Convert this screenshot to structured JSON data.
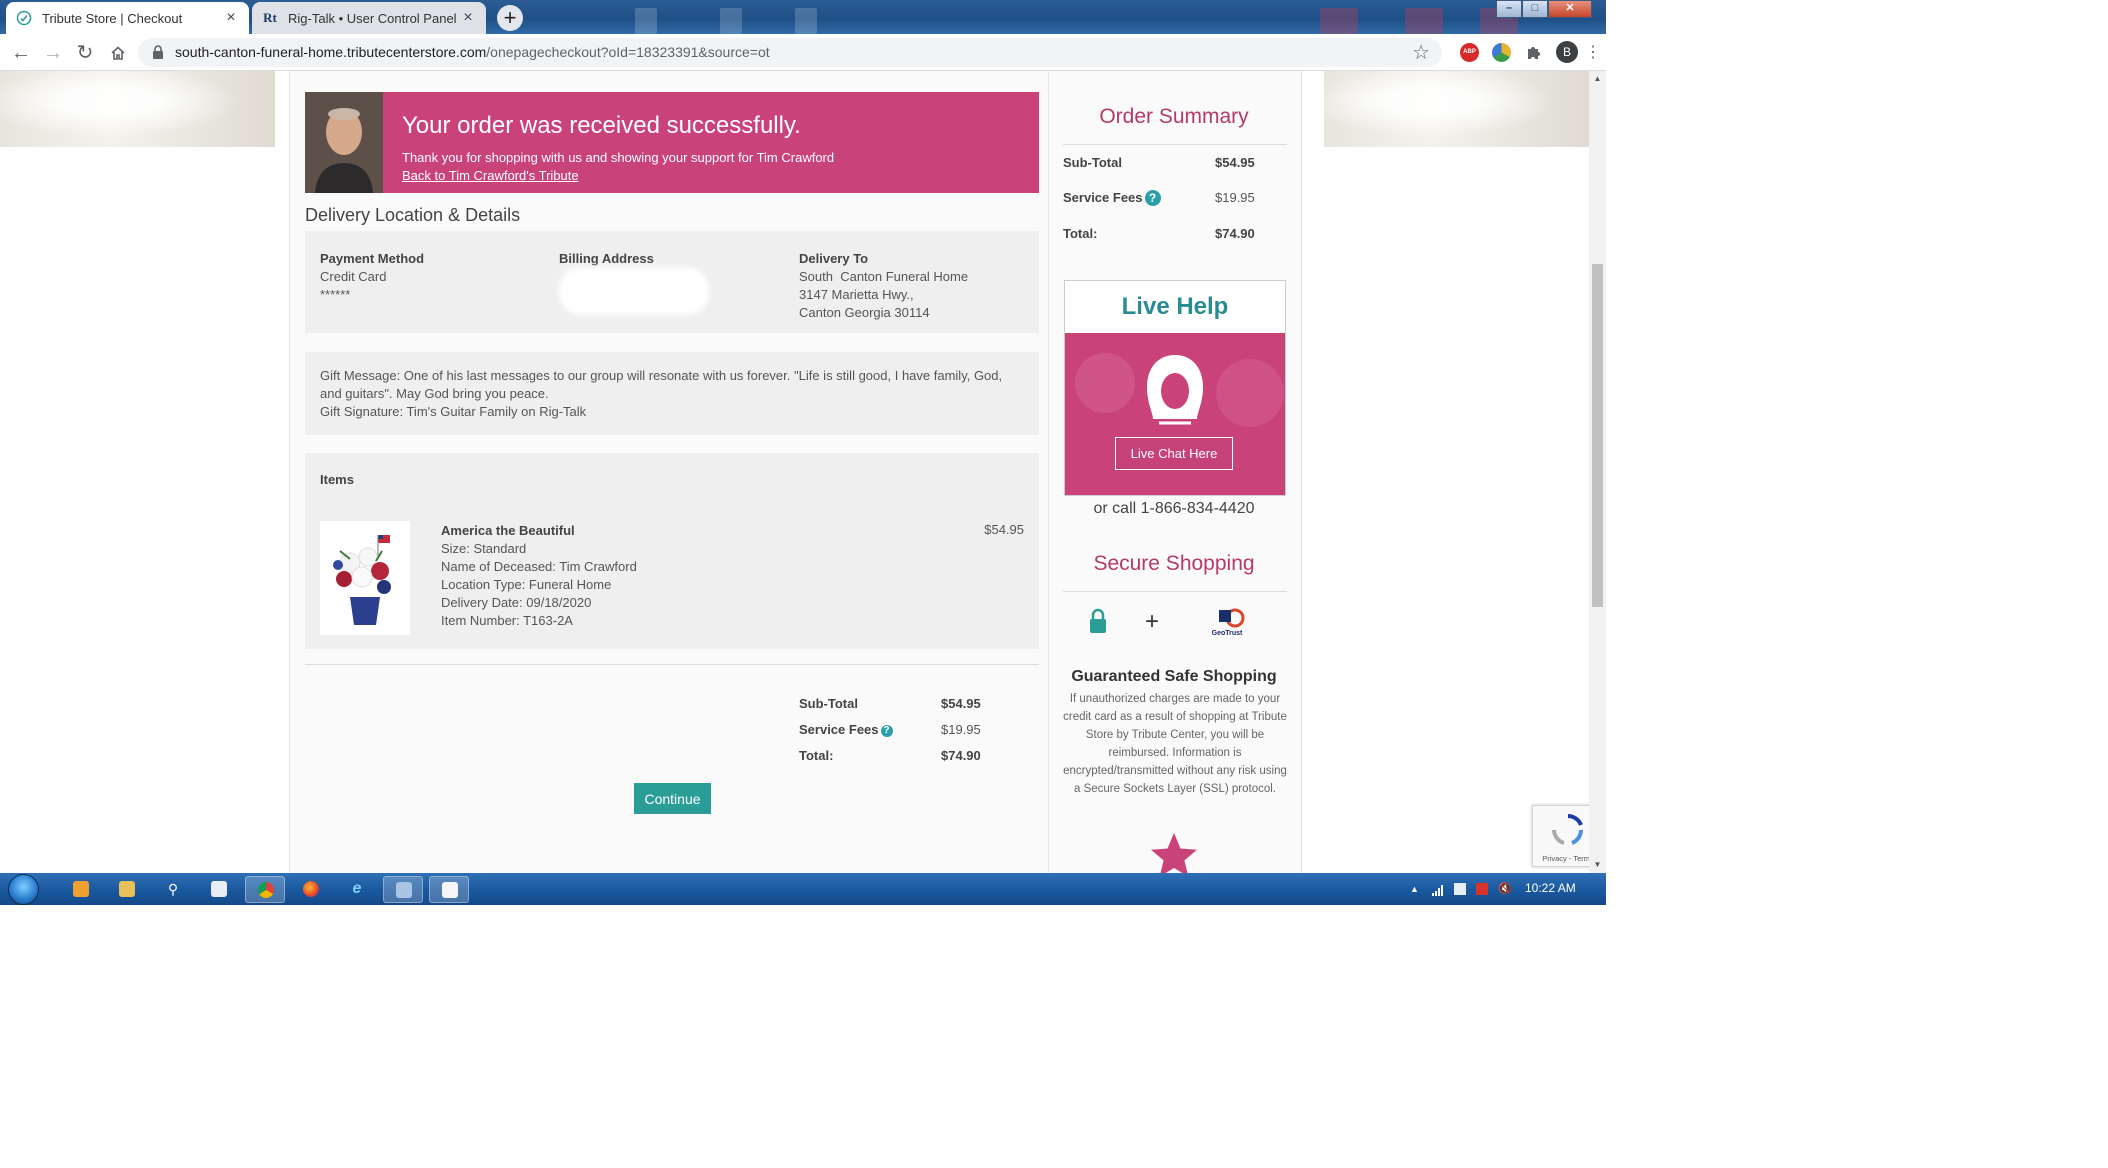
{
  "browser": {
    "tabs": [
      {
        "title": "Tribute Store | Checkout",
        "active": true
      },
      {
        "title": "Rig-Talk • User Control Panel • V",
        "favicon_text": "Rt",
        "active": false
      }
    ],
    "url_host": "south-canton-funeral-home.tributecenterstore.com",
    "url_path": "/onepagecheckout?oId=18323391&source=ot",
    "profile_initial": "B",
    "extension_badge": "ABP"
  },
  "banner": {
    "title": "Your order was received successfully.",
    "subtitle": "Thank you for shopping with us and showing your support for Tim Crawford",
    "link": "Back to Tim Crawford's Tribute"
  },
  "delivery": {
    "heading": "Delivery Location & Details",
    "payment_label": "Payment Method",
    "payment_value": "Credit Card",
    "payment_masked": "******",
    "billing_label": "Billing Address",
    "delivery_label": "Delivery To",
    "delivery_line1": "South  Canton Funeral Home",
    "delivery_line2": "3147 Marietta Hwy.,",
    "delivery_line3": "Canton Georgia 30114"
  },
  "gift": {
    "message": "Gift Message: One of his last messages to our group will resonate with us forever. \"Life is still good, I have family, God, and guitars\". May God bring you peace.",
    "signature": "Gift Signature: Tim's Guitar Family on Rig-Talk"
  },
  "items": {
    "heading": "Items",
    "list": [
      {
        "name": "America the Beautiful",
        "size": "Size: Standard",
        "deceased": "Name of Deceased: Tim Crawford",
        "location": "Location Type: Funeral Home",
        "date": "Delivery Date: 09/18/2020",
        "number": "Item Number: T163-2A",
        "price": "$54.95"
      }
    ]
  },
  "totals": {
    "subtotal_label": "Sub-Total",
    "subtotal": "$54.95",
    "fees_label": "Service Fees",
    "fees": "$19.95",
    "total_label": "Total:",
    "total": "$74.90",
    "help_glyph": "?"
  },
  "continue_label": "Continue",
  "sidebar": {
    "order_summary_title": "Order Summary",
    "live_help_title": "Live Help",
    "chat_label": "Live Chat Here",
    "call_text": "or call 1-866-834-4420",
    "secure_title": "Secure Shopping",
    "geotrust_label": "GeoTrust",
    "guarantee_title": "Guaranteed Safe Shopping",
    "guarantee_text": "If unauthorized charges are made to your credit card as a result of shopping at Tribute Store by Tribute Center, you will be reimbursed. Information is encrypted/transmitted without any risk using a Secure Sockets Layer (SSL) protocol."
  },
  "recaptcha_text": "Privacy - Terms",
  "taskbar": {
    "clock": "10:22 AM"
  },
  "colors": {
    "brand_pink": "#c9437a",
    "brand_teal": "#2a9d96",
    "title_pink": "#b53a6c"
  }
}
